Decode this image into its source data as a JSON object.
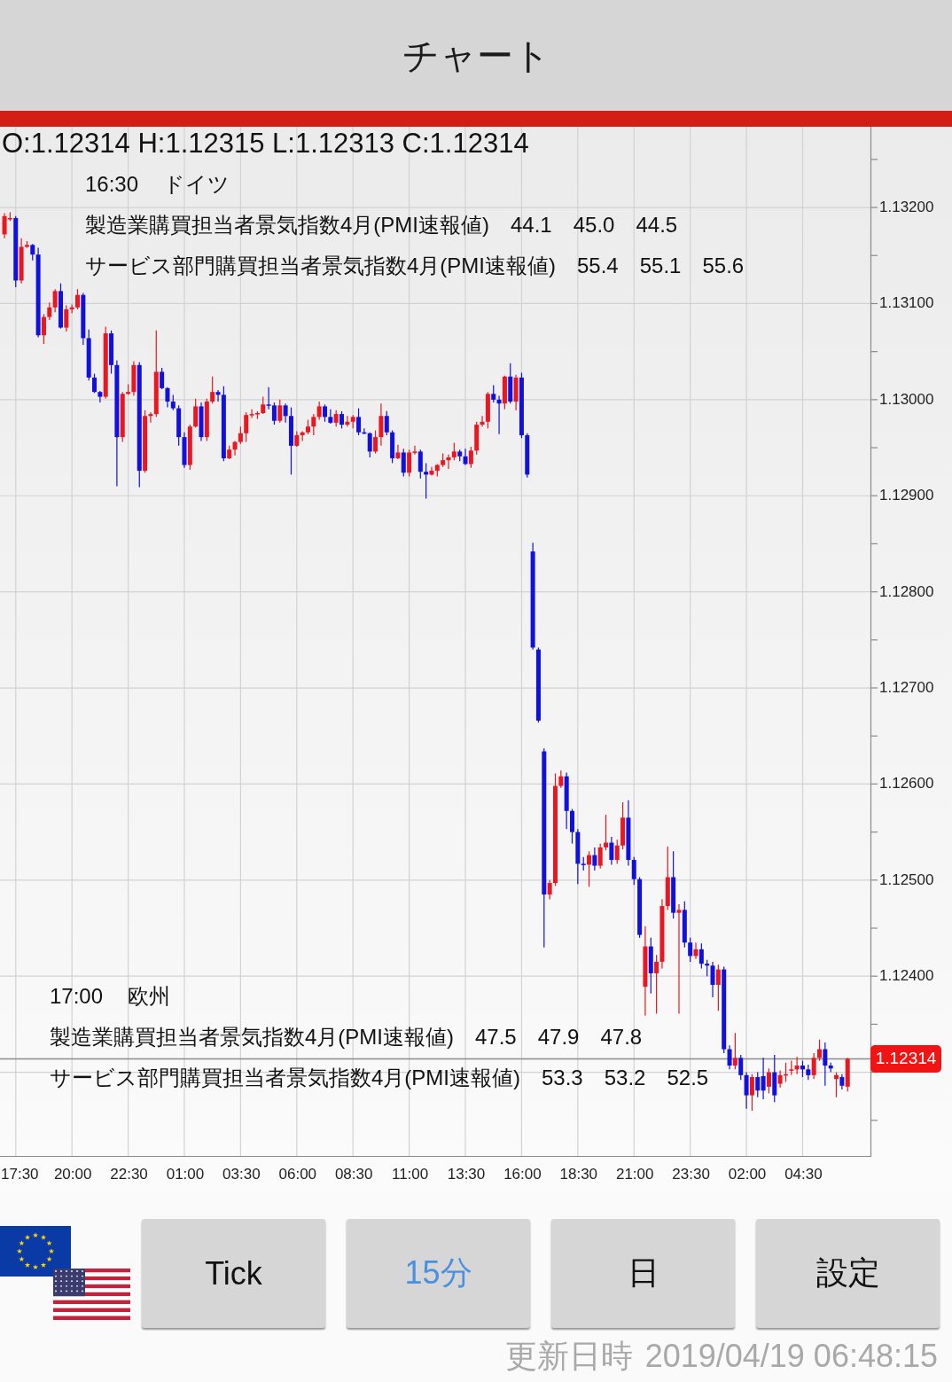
{
  "header": {
    "title": "チャート"
  },
  "chart": {
    "ohlc_readout": "O:1.12314 H:1.12315 L:1.12313 C:1.12314",
    "events": [
      {
        "time": "16:30",
        "region": "ドイツ",
        "indicators": [
          {
            "name": "製造業購買担当者景気指数4月(PMI速報値)",
            "values": [
              "44.1",
              "45.0",
              "44.5"
            ]
          },
          {
            "name": "サービス部門購買担当者景気指数4月(PMI速報値)",
            "values": [
              "55.4",
              "55.1",
              "55.6"
            ]
          }
        ]
      },
      {
        "time": "17:00",
        "region": "欧州",
        "indicators": [
          {
            "name": "製造業購買担当者景気指数4月(PMI速報値)",
            "values": [
              "47.5",
              "47.9",
              "47.8"
            ]
          },
          {
            "name": "サービス部門購買担当者景気指数4月(PMI速報値)",
            "values": [
              "53.3",
              "53.2",
              "52.5"
            ]
          }
        ]
      }
    ],
    "chart_data": {
      "type": "candlestick",
      "x": [
        "2019-04-17 17:00",
        "2019-04-17 17:15",
        "2019-04-17 17:30",
        "2019-04-17 17:45",
        "2019-04-17 18:00",
        "2019-04-17 18:15",
        "2019-04-17 18:30",
        "2019-04-17 18:45",
        "2019-04-17 19:00",
        "2019-04-17 19:15",
        "2019-04-17 19:30",
        "2019-04-17 19:45",
        "2019-04-17 20:00",
        "2019-04-17 20:15",
        "2019-04-17 20:30",
        "2019-04-17 20:45",
        "2019-04-17 21:00",
        "2019-04-17 21:15",
        "2019-04-17 21:30",
        "2019-04-17 21:45",
        "2019-04-17 22:00",
        "2019-04-17 22:15",
        "2019-04-17 22:30",
        "2019-04-17 22:45",
        "2019-04-17 23:00",
        "2019-04-17 23:15",
        "2019-04-17 23:30",
        "2019-04-17 23:45",
        "2019-04-18 00:00",
        "2019-04-18 00:15",
        "2019-04-18 00:30",
        "2019-04-18 00:45",
        "2019-04-18 01:00",
        "2019-04-18 01:15",
        "2019-04-18 01:30",
        "2019-04-18 01:45",
        "2019-04-18 02:00",
        "2019-04-18 02:15",
        "2019-04-18 02:30",
        "2019-04-18 02:45",
        "2019-04-18 03:00",
        "2019-04-18 03:15",
        "2019-04-18 03:30",
        "2019-04-18 03:45",
        "2019-04-18 04:00",
        "2019-04-18 04:15",
        "2019-04-18 04:30",
        "2019-04-18 04:45",
        "2019-04-18 05:00",
        "2019-04-18 05:15",
        "2019-04-18 05:30",
        "2019-04-18 05:45",
        "2019-04-18 06:00",
        "2019-04-18 06:15",
        "2019-04-18 06:30",
        "2019-04-18 06:45",
        "2019-04-18 07:00",
        "2019-04-18 07:15",
        "2019-04-18 07:30",
        "2019-04-18 07:45",
        "2019-04-18 08:00",
        "2019-04-18 08:15",
        "2019-04-18 08:30",
        "2019-04-18 08:45",
        "2019-04-18 09:00",
        "2019-04-18 09:15",
        "2019-04-18 09:30",
        "2019-04-18 09:45",
        "2019-04-18 10:00",
        "2019-04-18 10:15",
        "2019-04-18 10:30",
        "2019-04-18 10:45",
        "2019-04-18 11:00",
        "2019-04-18 11:15",
        "2019-04-18 11:30",
        "2019-04-18 11:45",
        "2019-04-18 12:00",
        "2019-04-18 12:15",
        "2019-04-18 12:30",
        "2019-04-18 12:45",
        "2019-04-18 13:00",
        "2019-04-18 13:15",
        "2019-04-18 13:30",
        "2019-04-18 13:45",
        "2019-04-18 14:00",
        "2019-04-18 14:15",
        "2019-04-18 14:30",
        "2019-04-18 14:45",
        "2019-04-18 15:00",
        "2019-04-18 15:15",
        "2019-04-18 15:30",
        "2019-04-18 15:45",
        "2019-04-18 16:00",
        "2019-04-18 16:15",
        "2019-04-18 16:30",
        "2019-04-18 16:45",
        "2019-04-18 17:00",
        "2019-04-18 17:15",
        "2019-04-18 17:30",
        "2019-04-18 17:45",
        "2019-04-18 18:00",
        "2019-04-18 18:15",
        "2019-04-18 18:30",
        "2019-04-18 18:45",
        "2019-04-18 19:00",
        "2019-04-18 19:15",
        "2019-04-18 19:30",
        "2019-04-18 19:45",
        "2019-04-18 20:00",
        "2019-04-18 20:15",
        "2019-04-18 20:30",
        "2019-04-18 20:45",
        "2019-04-18 21:00",
        "2019-04-18 21:15",
        "2019-04-18 21:30",
        "2019-04-18 21:45",
        "2019-04-18 22:00",
        "2019-04-18 22:15",
        "2019-04-18 22:30",
        "2019-04-18 22:45",
        "2019-04-18 23:00",
        "2019-04-18 23:15",
        "2019-04-18 23:30",
        "2019-04-18 23:45",
        "2019-04-19 00:00",
        "2019-04-19 00:15",
        "2019-04-19 00:30",
        "2019-04-19 00:45",
        "2019-04-19 01:00",
        "2019-04-19 01:15",
        "2019-04-19 01:30",
        "2019-04-19 01:45",
        "2019-04-19 02:00",
        "2019-04-19 02:15",
        "2019-04-19 02:30",
        "2019-04-19 02:45",
        "2019-04-19 03:00",
        "2019-04-19 03:15",
        "2019-04-19 03:30",
        "2019-04-19 03:45",
        "2019-04-19 04:00",
        "2019-04-19 04:15",
        "2019-04-19 04:30",
        "2019-04-19 04:45",
        "2019-04-19 05:00",
        "2019-04-19 05:15",
        "2019-04-19 05:30",
        "2019-04-19 05:45",
        "2019-04-19 06:00",
        "2019-04-19 06:15",
        "2019-04-19 06:30"
      ],
      "ohlc": [
        [
          1.13172,
          1.13194,
          1.13168,
          1.13191
        ],
        [
          1.13188,
          1.13195,
          1.13186,
          1.13189
        ],
        [
          1.13189,
          1.13191,
          1.13117,
          1.13124
        ],
        [
          1.13124,
          1.13168,
          1.13121,
          1.13159
        ],
        [
          1.13159,
          1.13165,
          1.13158,
          1.13161
        ],
        [
          1.13161,
          1.13162,
          1.13145,
          1.13151
        ],
        [
          1.13151,
          1.13158,
          1.13065,
          1.13067
        ],
        [
          1.13067,
          1.13089,
          1.13058,
          1.13086
        ],
        [
          1.13086,
          1.13101,
          1.13083,
          1.13096
        ],
        [
          1.13096,
          1.13115,
          1.13091,
          1.13113
        ],
        [
          1.13113,
          1.13121,
          1.13074,
          1.13075
        ],
        [
          1.13075,
          1.13098,
          1.13071,
          1.13094
        ],
        [
          1.13094,
          1.13099,
          1.1309,
          1.13096
        ],
        [
          1.13096,
          1.13115,
          1.13094,
          1.13109
        ],
        [
          1.13109,
          1.13111,
          1.13057,
          1.13064
        ],
        [
          1.13064,
          1.13073,
          1.1302,
          1.13023
        ],
        [
          1.13023,
          1.13027,
          1.13007,
          1.13008
        ],
        [
          1.13008,
          1.13009,
          1.12997,
          1.13003
        ],
        [
          1.13003,
          1.13076,
          1.13001,
          1.13069
        ],
        [
          1.13069,
          1.13072,
          1.13027,
          1.13036
        ],
        [
          1.13036,
          1.13041,
          1.1291,
          1.12961
        ],
        [
          1.12961,
          1.13008,
          1.12956,
          1.13006
        ],
        [
          1.13006,
          1.13016,
          1.13005,
          1.13008
        ],
        [
          1.13008,
          1.1304,
          1.13004,
          1.13036
        ],
        [
          1.13036,
          1.13039,
          1.12909,
          1.12926
        ],
        [
          1.12926,
          1.12989,
          1.12924,
          1.12983
        ],
        [
          1.12983,
          1.12987,
          1.12976,
          1.12985
        ],
        [
          1.12985,
          1.13072,
          1.12982,
          1.13029
        ],
        [
          1.13029,
          1.13033,
          1.13011,
          1.13012
        ],
        [
          1.13012,
          1.13013,
          1.12992,
          1.12998
        ],
        [
          1.12998,
          1.13005,
          1.12989,
          1.12991
        ],
        [
          1.12991,
          1.12994,
          1.12952,
          1.12961
        ],
        [
          1.12961,
          1.12966,
          1.12929,
          1.12932
        ],
        [
          1.12932,
          1.12974,
          1.12927,
          1.12972
        ],
        [
          1.12972,
          1.13001,
          1.12971,
          1.12993
        ],
        [
          1.12993,
          1.12997,
          1.12957,
          1.12961
        ],
        [
          1.12961,
          1.13001,
          1.12957,
          1.12998
        ],
        [
          1.12998,
          1.13024,
          1.12996,
          1.13008
        ],
        [
          1.13008,
          1.1301,
          1.12998,
          1.13005
        ],
        [
          1.13005,
          1.13014,
          1.12936,
          1.12939
        ],
        [
          1.12939,
          1.12952,
          1.12938,
          1.12948
        ],
        [
          1.12948,
          1.12957,
          1.12942,
          1.12956
        ],
        [
          1.12956,
          1.12972,
          1.12954,
          1.12965
        ],
        [
          1.12965,
          1.12987,
          1.12956,
          1.12984
        ],
        [
          1.12984,
          1.1299,
          1.12981,
          1.12985
        ],
        [
          1.12985,
          1.12988,
          1.1298,
          1.12986
        ],
        [
          1.12986,
          1.13003,
          1.12985,
          1.12995
        ],
        [
          1.12995,
          1.13013,
          1.1299,
          1.12994
        ],
        [
          1.12994,
          1.12997,
          1.12974,
          1.12978
        ],
        [
          1.12978,
          1.13,
          1.12976,
          1.12994
        ],
        [
          1.12994,
          1.12996,
          1.12976,
          1.12983
        ],
        [
          1.12983,
          1.12992,
          1.12922,
          1.12952
        ],
        [
          1.12952,
          1.12967,
          1.12951,
          1.12963
        ],
        [
          1.12963,
          1.12967,
          1.12957,
          1.12966
        ],
        [
          1.12966,
          1.12979,
          1.12964,
          1.12972
        ],
        [
          1.12972,
          1.12985,
          1.12963,
          1.12982
        ],
        [
          1.12982,
          1.12998,
          1.12979,
          1.12993
        ],
        [
          1.12993,
          1.12995,
          1.12977,
          1.12982
        ],
        [
          1.12982,
          1.1299,
          1.12975,
          1.12976
        ],
        [
          1.12976,
          1.12989,
          1.12972,
          1.12985
        ],
        [
          1.12985,
          1.12988,
          1.1297,
          1.12974
        ],
        [
          1.12974,
          1.12983,
          1.12972,
          1.12977
        ],
        [
          1.12977,
          1.12984,
          1.1297,
          1.12982
        ],
        [
          1.12982,
          1.12991,
          1.12963,
          1.12966
        ],
        [
          1.12966,
          1.1297,
          1.12964,
          1.12965
        ],
        [
          1.12965,
          1.12966,
          1.1294,
          1.12946
        ],
        [
          1.12946,
          1.12968,
          1.12944,
          1.12961
        ],
        [
          1.12961,
          1.12996,
          1.12952,
          1.12983
        ],
        [
          1.12983,
          1.12988,
          1.12963,
          1.12966
        ],
        [
          1.12966,
          1.12968,
          1.12934,
          1.12939
        ],
        [
          1.12939,
          1.12953,
          1.12938,
          1.12945
        ],
        [
          1.12945,
          1.12949,
          1.1292,
          1.12924
        ],
        [
          1.12924,
          1.12948,
          1.1292,
          1.12945
        ],
        [
          1.12945,
          1.12952,
          1.12943,
          1.12946
        ],
        [
          1.12946,
          1.12948,
          1.12918,
          1.12925
        ],
        [
          1.12925,
          1.12934,
          1.12897,
          1.12922
        ],
        [
          1.12922,
          1.1293,
          1.12921,
          1.12926
        ],
        [
          1.12926,
          1.12933,
          1.1292,
          1.12932
        ],
        [
          1.12932,
          1.12944,
          1.1293,
          1.12937
        ],
        [
          1.12937,
          1.12943,
          1.12928,
          1.1294
        ],
        [
          1.1294,
          1.12955,
          1.12937,
          1.12946
        ],
        [
          1.12946,
          1.12948,
          1.12936,
          1.12941
        ],
        [
          1.12941,
          1.12949,
          1.12932,
          1.12933
        ],
        [
          1.12933,
          1.12951,
          1.12929,
          1.12947
        ],
        [
          1.12947,
          1.12977,
          1.12943,
          1.12974
        ],
        [
          1.12974,
          1.12983,
          1.12972,
          1.12977
        ],
        [
          1.12977,
          1.13008,
          1.1297,
          1.13006
        ],
        [
          1.13006,
          1.13015,
          1.12997,
          1.13
        ],
        [
          1.13,
          1.13004,
          1.12964,
          1.12996
        ],
        [
          1.12996,
          1.13025,
          1.1299,
          1.13024
        ],
        [
          1.13024,
          1.13038,
          1.12996,
          1.12998
        ],
        [
          1.12998,
          1.13026,
          1.12989,
          1.13023
        ],
        [
          1.13023,
          1.13028,
          1.1296,
          1.12963
        ],
        [
          1.12963,
          1.12965,
          1.12919,
          1.12922
        ],
        [
          1.12842,
          1.12851,
          1.1274,
          1.12742
        ],
        [
          1.1274,
          1.12742,
          1.12664,
          1.12666
        ],
        [
          1.12634,
          1.12637,
          1.1243,
          1.12485
        ],
        [
          1.12485,
          1.125,
          1.1248,
          1.12497
        ],
        [
          1.12497,
          1.12611,
          1.12494,
          1.12598
        ],
        [
          1.12598,
          1.12614,
          1.12596,
          1.12608
        ],
        [
          1.12608,
          1.12612,
          1.12553,
          1.12572
        ],
        [
          1.12572,
          1.12574,
          1.12538,
          1.1255
        ],
        [
          1.1255,
          1.12553,
          1.12496,
          1.12517
        ],
        [
          1.12517,
          1.12524,
          1.1251,
          1.12516
        ],
        [
          1.12516,
          1.1253,
          1.12493,
          1.12526
        ],
        [
          1.12526,
          1.12534,
          1.1251,
          1.12515
        ],
        [
          1.12515,
          1.12538,
          1.12512,
          1.12534
        ],
        [
          1.12534,
          1.12568,
          1.12531,
          1.12539
        ],
        [
          1.12539,
          1.12545,
          1.12516,
          1.12521
        ],
        [
          1.12521,
          1.12542,
          1.12517,
          1.12536
        ],
        [
          1.12536,
          1.12581,
          1.12532,
          1.12565
        ],
        [
          1.12565,
          1.12583,
          1.12515,
          1.12521
        ],
        [
          1.12521,
          1.12524,
          1.12495,
          1.12501
        ],
        [
          1.12501,
          1.12503,
          1.1244,
          1.12443
        ],
        [
          1.12389,
          1.12452,
          1.12359,
          1.12431
        ],
        [
          1.12431,
          1.1244,
          1.12382,
          1.12403
        ],
        [
          1.12403,
          1.12422,
          1.12361,
          1.12415
        ],
        [
          1.12415,
          1.1248,
          1.12408,
          1.12473
        ],
        [
          1.12473,
          1.12535,
          1.12469,
          1.12503
        ],
        [
          1.12503,
          1.1253,
          1.1246,
          1.12466
        ],
        [
          1.12466,
          1.12475,
          1.12361,
          1.12469
        ],
        [
          1.12469,
          1.12478,
          1.1243,
          1.12435
        ],
        [
          1.12435,
          1.1244,
          1.12415,
          1.12421
        ],
        [
          1.12421,
          1.12435,
          1.12418,
          1.12428
        ],
        [
          1.12428,
          1.12434,
          1.12408,
          1.12413
        ],
        [
          1.12413,
          1.12417,
          1.124,
          1.12411
        ],
        [
          1.12411,
          1.12415,
          1.12378,
          1.12391
        ],
        [
          1.12391,
          1.12412,
          1.12364,
          1.12407
        ],
        [
          1.12407,
          1.1241,
          1.1232,
          1.12324
        ],
        [
          1.12324,
          1.12328,
          1.12303,
          1.12307
        ],
        [
          1.12307,
          1.12341,
          1.12303,
          1.12315
        ],
        [
          1.12315,
          1.12318,
          1.12292,
          1.12297
        ],
        [
          1.12297,
          1.123,
          1.12262,
          1.12276
        ],
        [
          1.12276,
          1.12298,
          1.1226,
          1.12295
        ],
        [
          1.12295,
          1.123,
          1.12274,
          1.12281
        ],
        [
          1.12296,
          1.12315,
          1.12272,
          1.12281
        ],
        [
          1.12285,
          1.12304,
          1.12278,
          1.123
        ],
        [
          1.123,
          1.12318,
          1.12269,
          1.12276
        ],
        [
          1.12288,
          1.12302,
          1.12284,
          1.12297
        ],
        [
          1.12297,
          1.1231,
          1.1229,
          1.12298
        ],
        [
          1.12302,
          1.12312,
          1.12297,
          1.12303
        ],
        [
          1.12303,
          1.12316,
          1.12298,
          1.12307
        ],
        [
          1.12307,
          1.12312,
          1.12295,
          1.12303
        ],
        [
          1.12303,
          1.12308,
          1.12292,
          1.12297
        ],
        [
          1.12297,
          1.1232,
          1.12293,
          1.12315
        ],
        [
          1.12315,
          1.12334,
          1.12312,
          1.12324
        ],
        [
          1.12324,
          1.12331,
          1.12286,
          1.12307
        ],
        [
          1.12307,
          1.1231,
          1.123,
          1.12304
        ],
        [
          1.12293,
          1.123,
          1.12274,
          1.12297
        ],
        [
          1.12295,
          1.12298,
          1.12282,
          1.12286
        ],
        [
          1.12285,
          1.12315,
          1.1228,
          1.12314
        ]
      ],
      "xlim": [
        "2019-04-17 16:48",
        "2019-04-19 07:31"
      ],
      "ylim": [
        1.12212,
        1.13284
      ],
      "xticks": [
        {
          "value": "2019-04-17 17:30",
          "label": "17:30"
        },
        {
          "value": "2019-04-17 20:00",
          "label": "20:00"
        },
        {
          "value": "2019-04-17 22:30",
          "label": "22:30"
        },
        {
          "value": "2019-04-18 01:00",
          "label": "01:00"
        },
        {
          "value": "2019-04-18 03:30",
          "label": "03:30"
        },
        {
          "value": "2019-04-18 06:00",
          "label": "06:00"
        },
        {
          "value": "2019-04-18 08:30",
          "label": "08:30"
        },
        {
          "value": "2019-04-18 11:00",
          "label": "11:00"
        },
        {
          "value": "2019-04-18 13:30",
          "label": "13:30"
        },
        {
          "value": "2019-04-18 16:00",
          "label": "16:00"
        },
        {
          "value": "2019-04-18 18:30",
          "label": "18:30"
        },
        {
          "value": "2019-04-18 21:00",
          "label": "21:00"
        },
        {
          "value": "2019-04-18 23:30",
          "label": "23:30"
        },
        {
          "value": "2019-04-19 02:00",
          "label": "02:00"
        },
        {
          "value": "2019-04-19 04:30",
          "label": "04:30"
        }
      ],
      "yticks": [
        {
          "value": 1.132,
          "label": "1.13200"
        },
        {
          "value": 1.131,
          "label": "1.13100"
        },
        {
          "value": 1.13,
          "label": "1.13000"
        },
        {
          "value": 1.129,
          "label": "1.12900"
        },
        {
          "value": 1.128,
          "label": "1.12800"
        },
        {
          "value": 1.127,
          "label": "1.12700"
        },
        {
          "value": 1.126,
          "label": "1.12600"
        },
        {
          "value": 1.125,
          "label": "1.12500"
        },
        {
          "value": 1.124,
          "label": "1.12400"
        }
      ],
      "grid": true,
      "ref_lines": [
        {
          "axis": "y",
          "value": 1.12314,
          "label": "1.12314"
        }
      ]
    }
  },
  "timeframes": [
    {
      "label": "Tick",
      "selected": false
    },
    {
      "label": "15分",
      "selected": true
    },
    {
      "label": "日",
      "selected": false
    }
  ],
  "settings_button": {
    "label": "設定"
  },
  "footer": {
    "label": "更新日時",
    "value": "2019/04/19 06:48:15"
  }
}
